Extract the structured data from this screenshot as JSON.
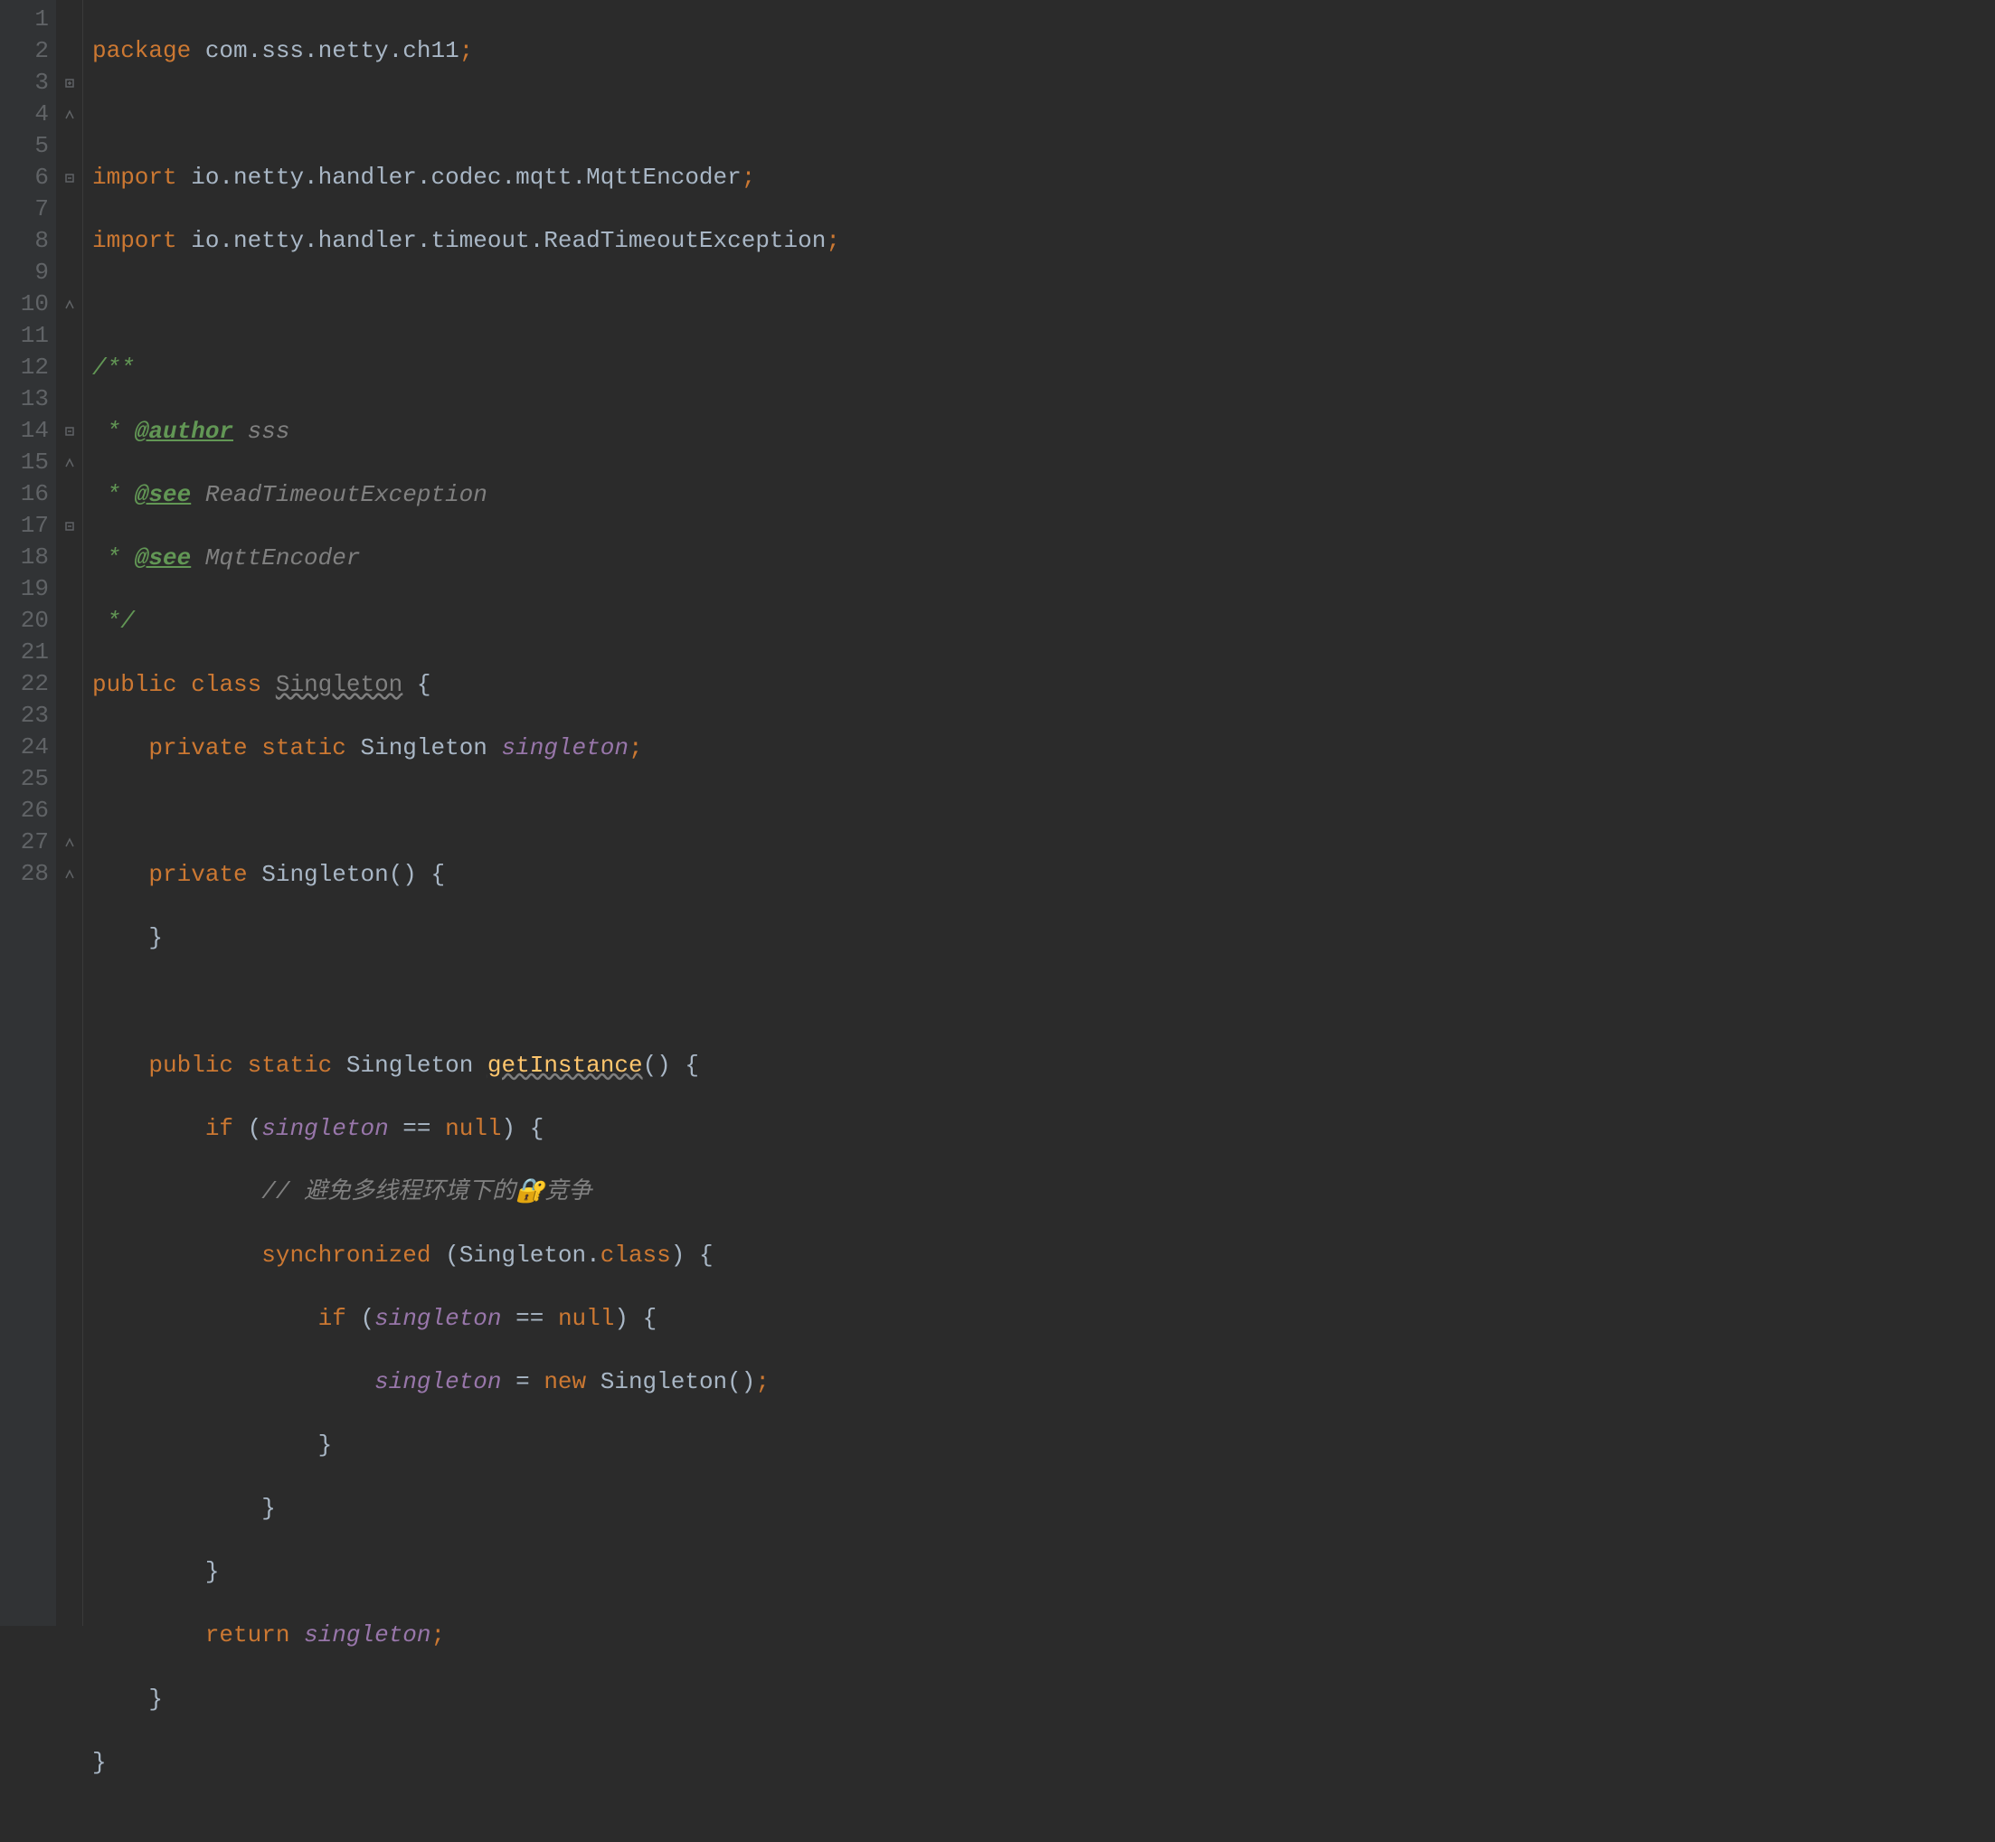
{
  "gutter": {
    "lines": [
      "1",
      "2",
      "3",
      "4",
      "5",
      "6",
      "7",
      "8",
      "9",
      "10",
      "11",
      "12",
      "13",
      "14",
      "15",
      "16",
      "17",
      "18",
      "19",
      "20",
      "21",
      "22",
      "23",
      "24",
      "25",
      "26",
      "27",
      "28"
    ]
  },
  "code": {
    "l1": {
      "kw": "package",
      "pkg": " com.sss.netty.ch11",
      "semi": ";"
    },
    "l3": {
      "kw": "import",
      "pkg": " io.netty.handler.codec.mqtt.MqttEncoder",
      "semi": ";"
    },
    "l4": {
      "kw": "import",
      "pkg": " io.netty.handler.timeout.ReadTimeoutException",
      "semi": ";"
    },
    "l6": {
      "doc": "/**"
    },
    "l7": {
      "star": " * ",
      "tag": "@author",
      "val": " sss"
    },
    "l8": {
      "star": " * ",
      "tag": "@see",
      "val": " ReadTimeoutException"
    },
    "l9": {
      "star": " * ",
      "tag": "@see",
      "val": " MqttEncoder"
    },
    "l10": {
      "doc": " */"
    },
    "l11": {
      "kw1": "public",
      "sp1": " ",
      "kw2": "class",
      "sp2": " ",
      "cls": "Singleton",
      "sp3": " ",
      "brace": "{"
    },
    "l12": {
      "indent": "    ",
      "kw1": "private",
      "sp1": " ",
      "kw2": "static",
      "sp2": " ",
      "type": "Singleton ",
      "field": "singleton",
      "semi": ";"
    },
    "l14": {
      "indent": "    ",
      "kw1": "private",
      "sp1": " ",
      "ctor": "Singleton",
      "paren": "() ",
      "brace": "{"
    },
    "l15": {
      "indent": "    ",
      "brace": "}"
    },
    "l17": {
      "indent": "    ",
      "kw1": "public",
      "sp1": " ",
      "kw2": "static",
      "sp2": " ",
      "type": "Singleton ",
      "method": "getInstance",
      "paren": "() ",
      "brace": "{"
    },
    "l18": {
      "indent": "        ",
      "kw": "if",
      "sp": " ",
      "open": "(",
      "field": "singleton",
      "op": " == ",
      "null": "null",
      "close": ") ",
      "brace": "{"
    },
    "l19": {
      "indent": "            ",
      "comment": "// 避免多线程环境下的🔐竞争"
    },
    "l20": {
      "indent": "            ",
      "kw": "synchronized",
      "sp": " ",
      "open": "(",
      "type": "Singleton",
      "dot": ".",
      "cls": "class",
      "close": ") ",
      "brace": "{"
    },
    "l21": {
      "indent": "                ",
      "kw": "if",
      "sp": " ",
      "open": "(",
      "field": "singleton",
      "op": " == ",
      "null": "null",
      "close": ") ",
      "brace": "{"
    },
    "l22": {
      "indent": "                    ",
      "field": "singleton",
      "eq": " = ",
      "new": "new",
      "sp": " ",
      "type": "Singleton()",
      "semi": ";"
    },
    "l23": {
      "indent": "                ",
      "brace": "}"
    },
    "l24": {
      "indent": "            ",
      "brace": "}"
    },
    "l25": {
      "indent": "        ",
      "brace": "}"
    },
    "l26": {
      "indent": "        ",
      "kw": "return",
      "sp": " ",
      "field": "singleton",
      "semi": ";"
    },
    "l27": {
      "indent": "    ",
      "brace": "}"
    },
    "l28": {
      "brace": "}"
    }
  }
}
